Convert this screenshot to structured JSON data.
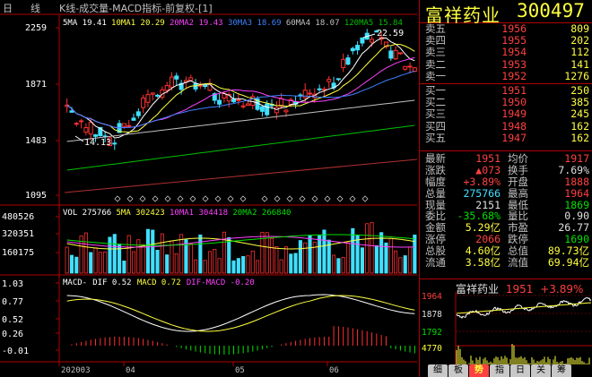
{
  "title_bar": {
    "period": "日",
    "mode": "线",
    "indicators": "K线-成交量-MACD指标-前复权-[1]"
  },
  "price_panel": {
    "ma_legend": [
      {
        "label": "5MA 19.41",
        "color": "#ffffff"
      },
      {
        "label": "10MA1 20.29",
        "color": "#ffff40"
      },
      {
        "label": "20MA2 19.43",
        "color": "#ff40ff"
      },
      {
        "label": "30MA3 18.69",
        "color": "#4080ff"
      },
      {
        "label": "60MA4 18.07",
        "color": "#c0c0c0"
      },
      {
        "label": "120MA5 15.84",
        "color": "#00c000"
      }
    ],
    "y_labels": [
      "2259",
      "1871",
      "1483",
      "1095"
    ],
    "high_annotation": "22.59",
    "low_annotation": "14.13"
  },
  "volume_panel": {
    "legend": [
      {
        "label": "VOL 275766",
        "color": "#ffffff"
      },
      {
        "label": "5MA 302423",
        "color": "#ffff40"
      },
      {
        "label": "10MA1 304418",
        "color": "#ff40ff"
      },
      {
        "label": "20MA2 266840",
        "color": "#00e000"
      }
    ],
    "y_labels": [
      "480526",
      "320351",
      "160175"
    ]
  },
  "macd_panel": {
    "legend": [
      {
        "label": "MACD-",
        "color": "#ffffff"
      },
      {
        "label": "DIF 0.52",
        "color": "#ffffff"
      },
      {
        "label": "MACD 0.72",
        "color": "#ffff40"
      },
      {
        "label": "DIF-MACD -0.20",
        "color": "#ff40ff"
      }
    ],
    "y_labels": [
      "1.03",
      "0.77",
      "0.52",
      "0.26",
      "-0.01"
    ]
  },
  "x_axis": [
    "202003",
    "04",
    "05",
    "06"
  ],
  "stock": {
    "name": "富祥药业",
    "code": "300497"
  },
  "sell_book": [
    {
      "label": "卖五",
      "price": "1956",
      "volume": "809"
    },
    {
      "label": "卖四",
      "price": "1955",
      "volume": "202"
    },
    {
      "label": "卖三",
      "price": "1954",
      "volume": "112"
    },
    {
      "label": "卖二",
      "price": "1953",
      "volume": "141"
    },
    {
      "label": "卖一",
      "price": "1952",
      "volume": "1276"
    }
  ],
  "buy_book": [
    {
      "label": "买一",
      "price": "1951",
      "volume": "250"
    },
    {
      "label": "买二",
      "price": "1950",
      "volume": "385"
    },
    {
      "label": "买三",
      "price": "1949",
      "volume": "245"
    },
    {
      "label": "买四",
      "price": "1948",
      "volume": "162"
    },
    {
      "label": "买五",
      "price": "1947",
      "volume": "162"
    }
  ],
  "stats": [
    {
      "l1": "最新",
      "v1": "1951",
      "c1": "red",
      "l2": "均价",
      "v2": "1917",
      "c2": "red"
    },
    {
      "l1": "涨跌",
      "v1": "▲073",
      "c1": "red",
      "l2": "换手",
      "v2": "7.69%",
      "c2": "white"
    },
    {
      "l1": "幅度",
      "v1": "+3.89%",
      "c1": "red",
      "l2": "开盘",
      "v2": "1888",
      "c2": "red"
    },
    {
      "l1": "总量",
      "v1": "275766",
      "c1": "cyan",
      "l2": "最高",
      "v2": "1964",
      "c2": "red"
    },
    {
      "l1": "现量",
      "v1": "2151",
      "c1": "white",
      "l2": "最低",
      "v2": "1869",
      "c2": "green"
    },
    {
      "l1": "委比",
      "v1": "-35.68%",
      "c1": "green",
      "l2": "量比",
      "v2": "0.90",
      "c2": "white"
    },
    {
      "l1": "金额",
      "v1": "5.29亿",
      "c1": "yellow",
      "l2": "市盈",
      "v2": "26.77",
      "c2": "white"
    },
    {
      "l1": "涨停",
      "v1": "2066",
      "c1": "red",
      "l2": "跌停",
      "v2": "1690",
      "c2": "green"
    },
    {
      "l1": "总股",
      "v1": "4.60亿",
      "c1": "yellow",
      "l2": "总值",
      "v2": "89.73亿",
      "c2": "yellow"
    },
    {
      "l1": "流通",
      "v1": "3.58亿",
      "c1": "yellow",
      "l2": "流值",
      "v2": "69.94亿",
      "c2": "yellow"
    }
  ],
  "mini_chart": {
    "name": "富祥药业",
    "price": "1951",
    "change": "+3.89%",
    "y_labels": [
      {
        "text": "1964",
        "color": "#ff4040"
      },
      {
        "text": "1878",
        "color": "#e0e0e0"
      },
      {
        "text": "1792",
        "color": "#00e000"
      },
      {
        "text": "4770",
        "color": "#ffff40"
      }
    ]
  },
  "tabs": [
    "细",
    "板",
    "势",
    "指",
    "日",
    "关",
    "筹"
  ],
  "active_tab": 2,
  "chart_data": {
    "type": "candlestick",
    "x_ticks": [
      "202003",
      "04",
      "05",
      "06"
    ],
    "price_range": [
      10.95,
      22.59
    ],
    "high": 22.59,
    "low": 14.13,
    "moving_averages": {
      "MA5": 19.41,
      "MA10": 20.29,
      "MA20": 19.43,
      "MA30": 18.69,
      "MA60": 18.07,
      "MA120": 15.84
    },
    "volume": {
      "VOL": 275766,
      "MA5": 302423,
      "MA10": 304418,
      "MA20": 266840
    },
    "macd": {
      "DIF": 0.52,
      "MACD": 0.72,
      "DIF_MACD": -0.2
    }
  }
}
